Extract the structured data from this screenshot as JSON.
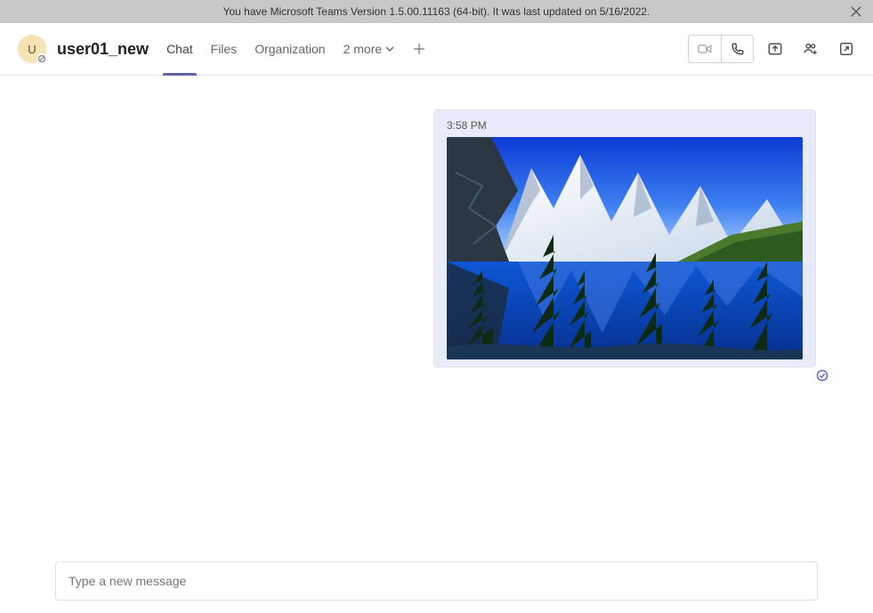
{
  "notification": {
    "text": "You have Microsoft Teams Version 1.5.00.11163 (64-bit). It was last updated on 5/16/2022."
  },
  "header": {
    "avatar_initial": "U",
    "user_name": "user01_new",
    "tabs": {
      "chat": "Chat",
      "files": "Files",
      "organization": "Organization",
      "more": "2 more"
    }
  },
  "message": {
    "timestamp": "3:58 PM"
  },
  "composer": {
    "placeholder": "Type a new message"
  },
  "colors": {
    "accent": "#6264a7",
    "bubble": "#e8ebfa"
  }
}
